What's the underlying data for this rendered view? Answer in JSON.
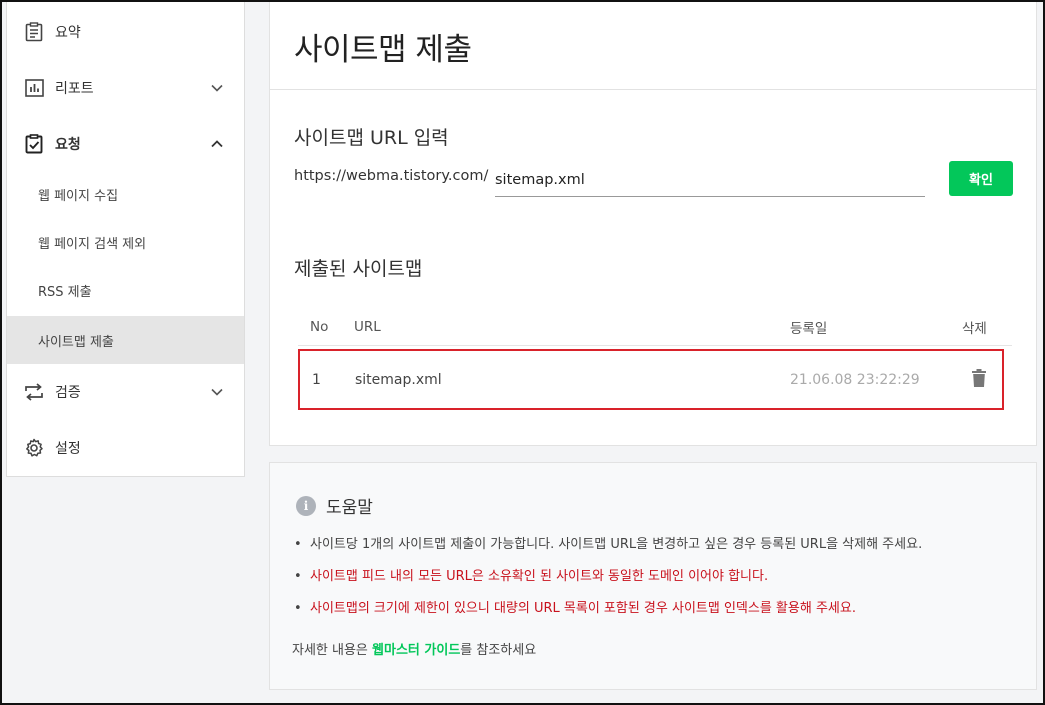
{
  "sidebar": {
    "items": [
      {
        "label": "요약",
        "icon": "clipboard-list-icon"
      },
      {
        "label": "리포트",
        "icon": "bar-chart-icon"
      },
      {
        "label": "요청",
        "icon": "clipboard-check-icon"
      },
      {
        "label": "검증",
        "icon": "repeat-arrows-icon"
      },
      {
        "label": "설정",
        "icon": "gear-icon"
      }
    ],
    "subitems": [
      {
        "label": "웹 페이지 수집"
      },
      {
        "label": "웹 페이지 검색 제외"
      },
      {
        "label": "RSS 제출"
      },
      {
        "label": "사이트맵 제출"
      }
    ]
  },
  "page": {
    "title": "사이트맵 제출"
  },
  "form": {
    "section_title": "사이트맵 URL 입력",
    "base_url": "https://webma.tistory.com/",
    "input_value": "sitemap.xml",
    "confirm_label": "확인"
  },
  "submitted": {
    "section_title": "제출된 사이트맵",
    "headers": {
      "no": "No",
      "url": "URL",
      "date": "등록일",
      "delete": "삭제"
    },
    "rows": [
      {
        "no": "1",
        "url": "sitemap.xml",
        "date": "21.06.08 23:22:29"
      }
    ]
  },
  "help": {
    "title": "도움말",
    "items": [
      "사이트당 1개의 사이트맵 제출이 가능합니다. 사이트맵 URL을 변경하고 싶은 경우 등록된 URL을 삭제해 주세요.",
      "사이트맵 피드 내의 모든 URL은 소유확인 된 사이트와 동일한 도메인 이어야 합니다.",
      "사이트맵의 크기에 제한이 있으니 대량의 URL 목록이 포함된 경우 사이트맵 인덱스를 활용해 주세요."
    ],
    "footer_prefix": "자세한 내용은 ",
    "footer_link": "웹마스터 가이드",
    "footer_suffix": "를 참조하세요"
  },
  "colors": {
    "accent_green": "#03c75a",
    "highlight_red": "#d9222a",
    "warning_text": "#c8121d"
  }
}
